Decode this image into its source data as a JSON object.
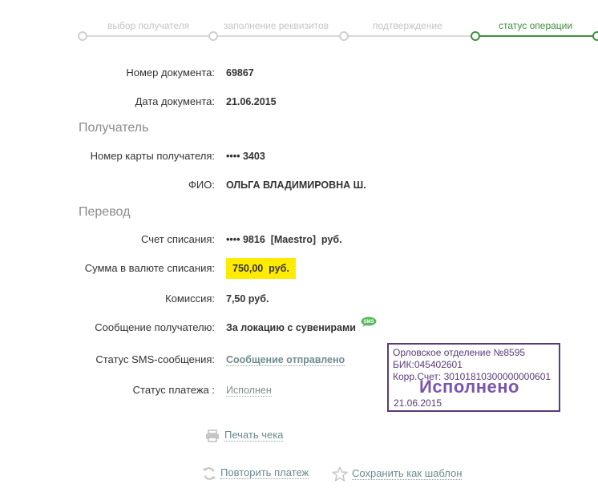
{
  "steps": [
    {
      "label": "выбор получателя",
      "active": false
    },
    {
      "label": "заполнение реквизитов",
      "active": false
    },
    {
      "label": "подтверждение",
      "active": false
    },
    {
      "label": "статус операции",
      "active": true
    }
  ],
  "document": {
    "number_label": "Номер документа:",
    "number_value": "69867",
    "date_label": "Дата документа:",
    "date_value": "21.06.2015"
  },
  "recipient": {
    "section_title": "Получатель",
    "card_label": "Номер карты получателя:",
    "card_value": "•••• 3403",
    "name_label": "ФИО:",
    "name_value": "ОЛЬГА ВЛАДИМИРОВНА Ш."
  },
  "transfer": {
    "section_title": "Перевод",
    "account_label": "Счет списания:",
    "account_value": "•••• 9816  [Maestro]  руб.",
    "amount_label": "Сумма в валюте списания:",
    "amount_value": "750,00  руб.",
    "fee_label": "Комиссия:",
    "fee_value": "7,50 руб.",
    "message_label": "Сообщение получателю:",
    "message_value": "За локацию с сувенирами",
    "sms_icon_text": "SMS",
    "sms_status_label": "Статус SMS-сообщения:",
    "sms_status_value": "Сообщение отправлено",
    "payment_status_label": "Статус платежа :",
    "payment_status_value": "Исполнен"
  },
  "stamp": {
    "line1": "Орловское отделение №8595",
    "line2": "БИК:045402601",
    "line3": "Корр.Счет: 30101810300000000601",
    "status": "Исполнено",
    "date": "21.06.2015",
    "color": "#5a3a7a"
  },
  "actions": {
    "print_label": "Печать чека",
    "repeat_label": "Повторить платеж",
    "save_label": "Сохранить как шаблон"
  },
  "colors": {
    "accent": "#3f8f3f",
    "highlight": "#ffeb00",
    "link": "#6f8b8f"
  }
}
